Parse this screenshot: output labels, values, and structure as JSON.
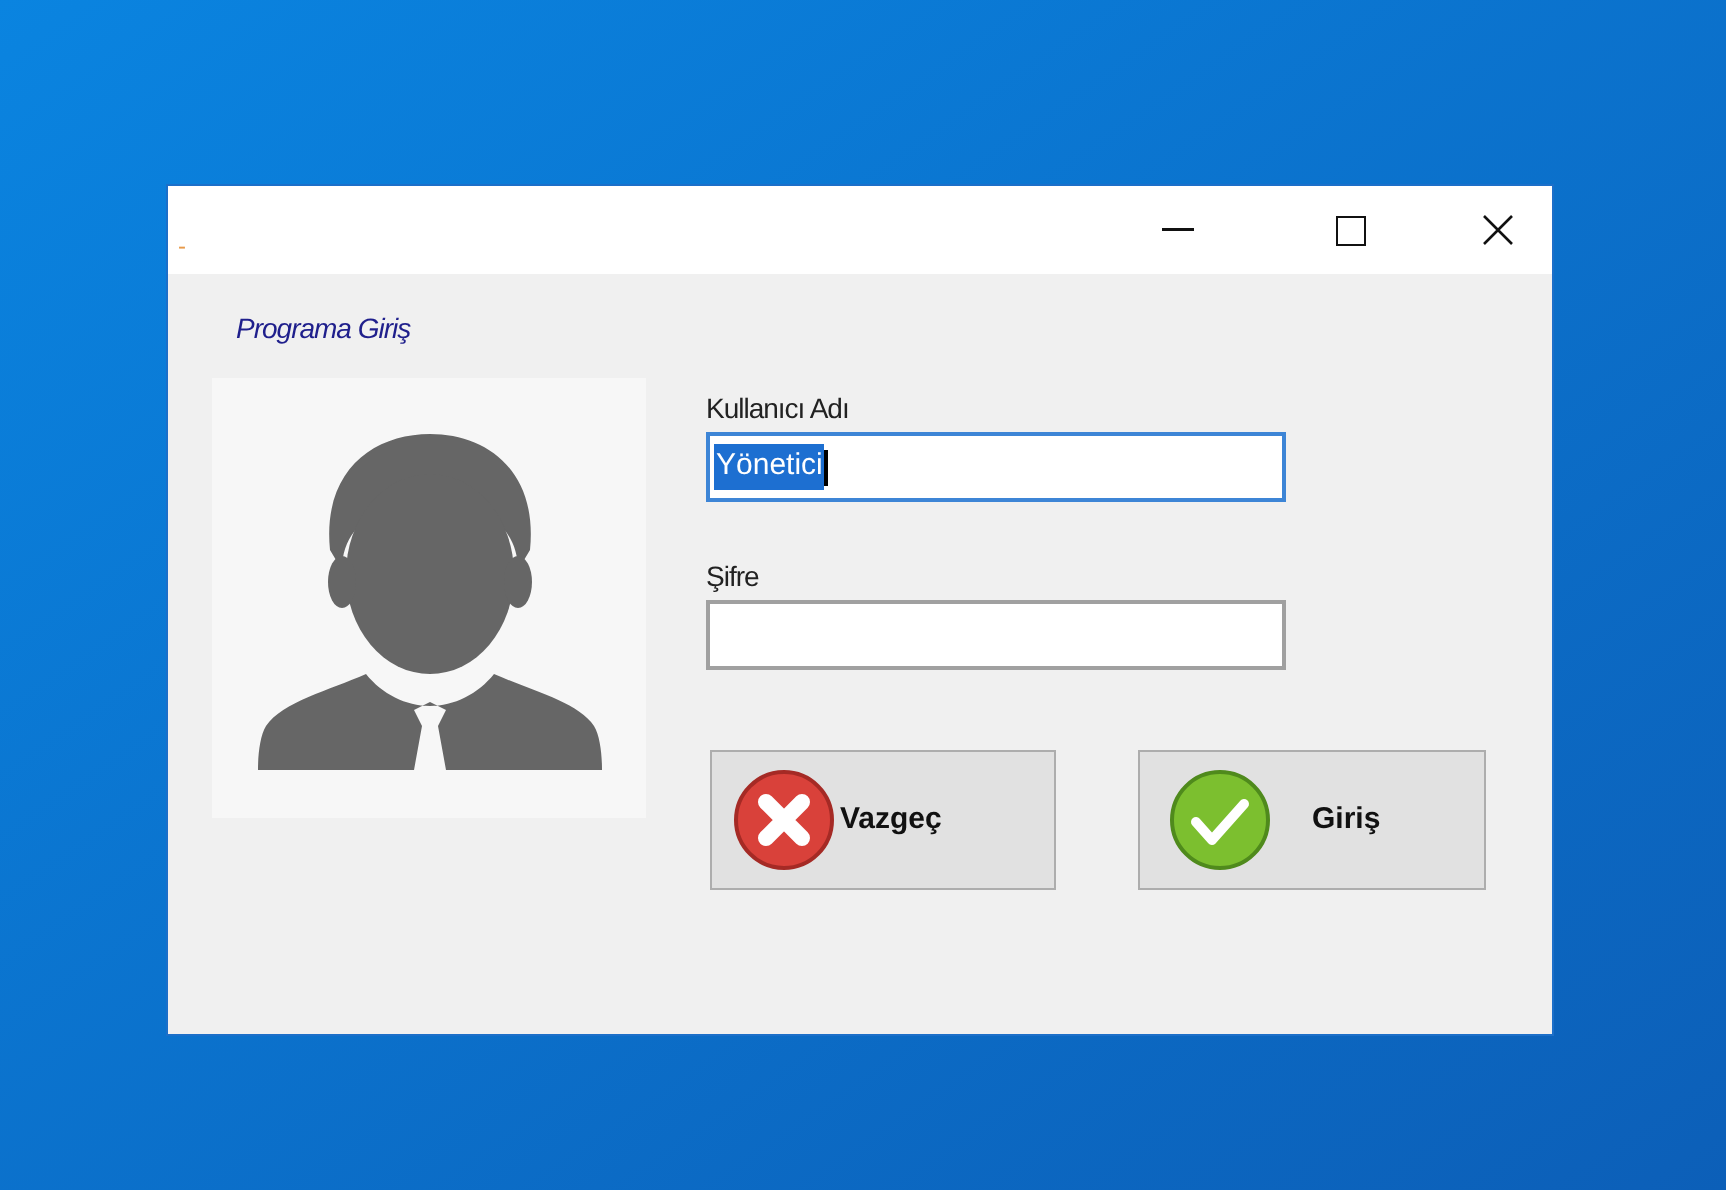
{
  "window": {
    "title_mark": "-"
  },
  "heading": "Programa Giriş",
  "fields": [
    {
      "label": "Kullanıcı Adı",
      "value": "Yönetici",
      "focused": true
    },
    {
      "label": "Şifre",
      "focused": false
    }
  ],
  "buttons": [
    {
      "kind": "cancel",
      "label": "Vazgeç"
    },
    {
      "kind": "confirm",
      "label": "Giriş"
    }
  ]
}
